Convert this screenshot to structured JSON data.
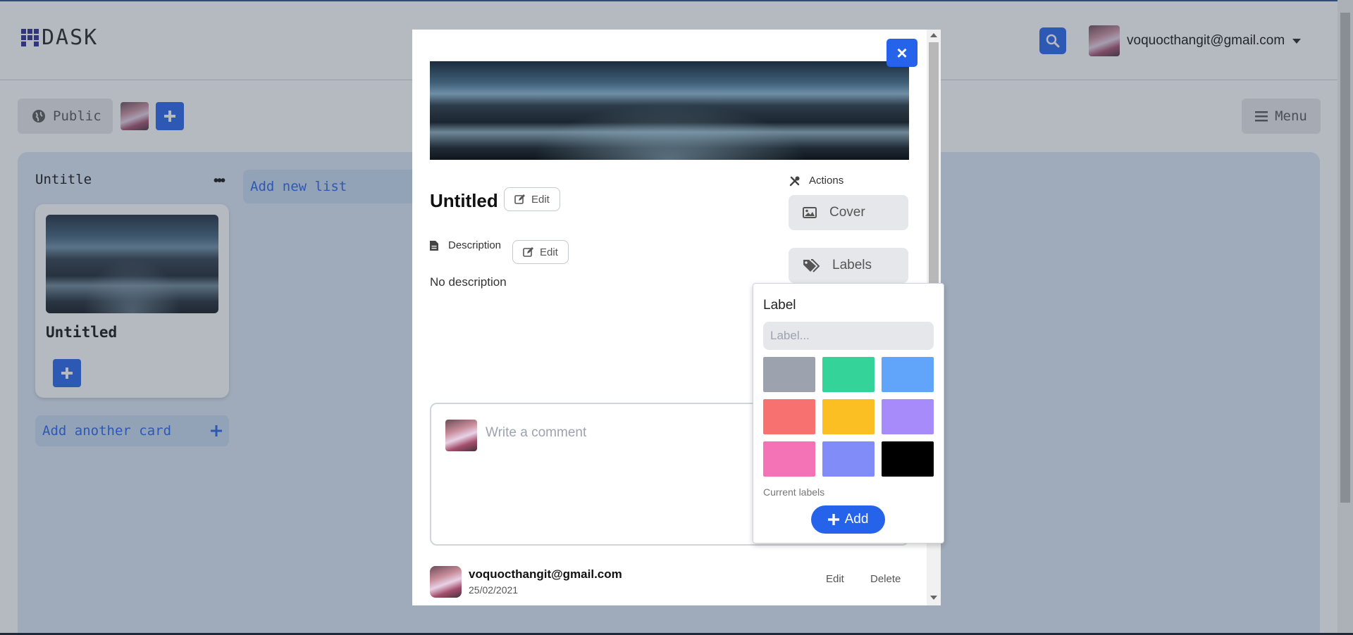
{
  "app": {
    "logo_text": "DASK"
  },
  "header": {
    "user_email": "voquocthangit@gmail.com"
  },
  "subbar": {
    "visibility_label": "Public",
    "menu_label": "Menu"
  },
  "board": {
    "list_title": "Untitle",
    "card_title": "Untitled",
    "add_card_label": "Add another card",
    "add_list_label": "Add new list"
  },
  "modal": {
    "card_name": "Untitled",
    "title_edit_label": "Edit",
    "description_label": "Description",
    "description_edit_label": "Edit",
    "description_text": "No description",
    "actions_label": "Actions",
    "cover_button_label": "Cover",
    "labels_button_label": "Labels",
    "close_label": "×",
    "comment_placeholder": "Write a comment",
    "comments": [
      {
        "author": "voquocthangit@gmail.com",
        "date": "25/02/2021",
        "edit_label": "Edit",
        "delete_label": "Delete"
      }
    ]
  },
  "label_popover": {
    "title": "Label",
    "input_placeholder": "Label...",
    "swatch_colors": [
      "#9ca3af",
      "#34d399",
      "#60a5fa",
      "#f87171",
      "#fbbf24",
      "#a78bfa",
      "#f472b6",
      "#818cf8",
      "#000000"
    ],
    "current_labels_text": "Current labels",
    "add_label": "Add"
  },
  "colors": {
    "accent": "#2563eb",
    "board_bg": "#dbe7f5"
  }
}
